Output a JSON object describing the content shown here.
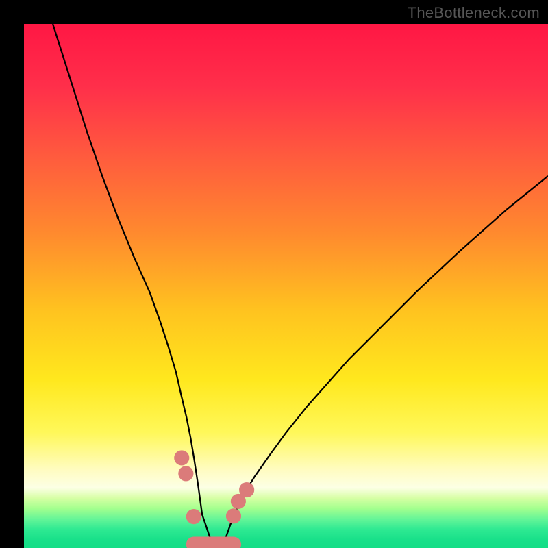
{
  "watermark": "TheBottleneck.com",
  "chart_data": {
    "type": "line",
    "title": "",
    "xlabel": "",
    "ylabel": "",
    "xlim": [
      0,
      100
    ],
    "ylim": [
      0,
      100
    ],
    "background": {
      "type": "vertical-gradient",
      "stops": [
        {
          "offset": 0.0,
          "color": "#ff1744"
        },
        {
          "offset": 0.12,
          "color": "#ff2f4a"
        },
        {
          "offset": 0.25,
          "color": "#ff5a3e"
        },
        {
          "offset": 0.4,
          "color": "#ff8a2e"
        },
        {
          "offset": 0.55,
          "color": "#ffc41f"
        },
        {
          "offset": 0.68,
          "color": "#ffe81e"
        },
        {
          "offset": 0.78,
          "color": "#fff85a"
        },
        {
          "offset": 0.85,
          "color": "#fffcc0"
        },
        {
          "offset": 0.885,
          "color": "#fcffe5"
        },
        {
          "offset": 0.905,
          "color": "#d6ffa4"
        },
        {
          "offset": 0.925,
          "color": "#a2ff8e"
        },
        {
          "offset": 0.945,
          "color": "#64f598"
        },
        {
          "offset": 0.965,
          "color": "#2de992"
        },
        {
          "offset": 0.985,
          "color": "#18e089"
        },
        {
          "offset": 1.0,
          "color": "#14dd86"
        }
      ]
    },
    "series": [
      {
        "name": "bottleneck-curve",
        "stroke": "#000000",
        "x": [
          5.5,
          9,
          12,
          15,
          18,
          21,
          24,
          26,
          27.5,
          29,
          30,
          31,
          31.8,
          32.5,
          33.2,
          34,
          36,
          38,
          40,
          42,
          44,
          47,
          50,
          54,
          58,
          62,
          68,
          75,
          83,
          92,
          100
        ],
        "y": [
          100,
          89,
          79.5,
          70.8,
          62.8,
          55.5,
          48.8,
          43.2,
          38.6,
          33.6,
          29.2,
          25,
          21,
          16.8,
          12.2,
          6.4,
          0.5,
          0.5,
          6.2,
          10.4,
          13.6,
          17.9,
          22,
          27,
          31.5,
          36,
          42,
          49,
          56.5,
          64.5,
          71
        ]
      }
    ],
    "markers": {
      "name": "highlight-dots",
      "color": "#db7b7a",
      "radius_domain": 1.45,
      "points": [
        {
          "x": 30.1,
          "y": 17.2
        },
        {
          "x": 30.9,
          "y": 14.2
        },
        {
          "x": 32.4,
          "y": 6.0
        },
        {
          "x": 40.0,
          "y": 6.1
        },
        {
          "x": 40.9,
          "y": 8.9
        },
        {
          "x": 42.5,
          "y": 11.1
        }
      ]
    },
    "floor_segment": {
      "name": "floor-blob",
      "color": "#db7b7a",
      "y": 0.7,
      "x_start": 32.4,
      "x_end": 40.0,
      "thickness_domain": 2.9
    }
  }
}
